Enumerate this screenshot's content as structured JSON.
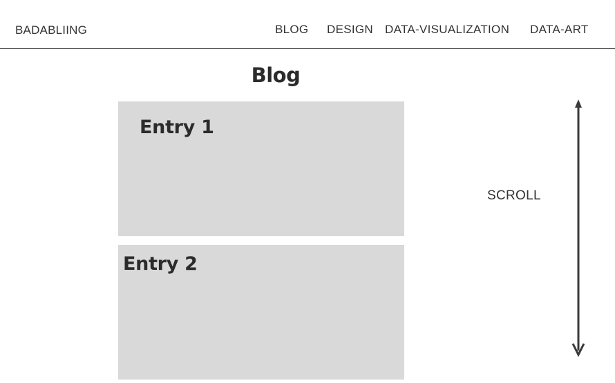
{
  "header": {
    "brand": "BADABLIING",
    "nav": [
      {
        "label": "BLOG"
      },
      {
        "label": "DESIGN"
      },
      {
        "label": "DATA-VISUALIZATION"
      },
      {
        "label": "DATA-ART"
      }
    ]
  },
  "main": {
    "title": "Blog",
    "entries": [
      {
        "title": "Entry 1"
      },
      {
        "title": "Entry 2"
      }
    ]
  },
  "scroll": {
    "label": "SCROLL",
    "icon": "double-arrow-vertical-icon"
  },
  "colors": {
    "card_background": "#d9d9d9",
    "text": "#333333",
    "arrow": "#3a3a3a",
    "divider": "#444444"
  }
}
